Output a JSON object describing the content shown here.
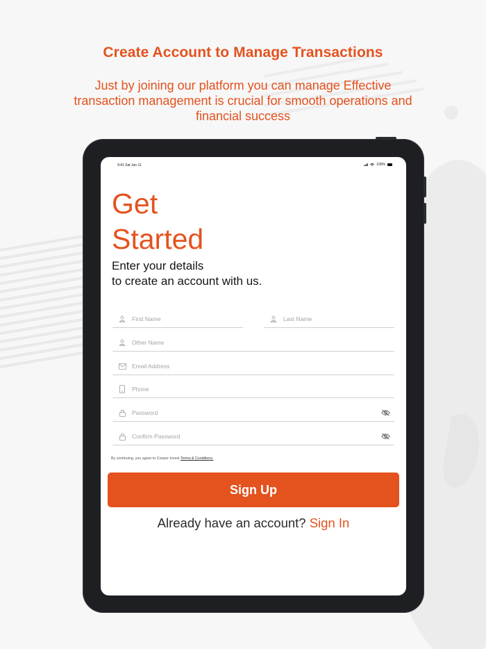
{
  "colors": {
    "accent": "#e4521e",
    "background": "#f7f7f7",
    "device_frame": "#1d1f22",
    "screen": "#ffffff"
  },
  "promo": {
    "headline": "Create Account to Manage Transactions",
    "subhead": "Just by joining our platform you can manage Effective transaction management is crucial for smooth operations and financial success"
  },
  "statusbar": {
    "time": "9:41  Sat Jun 11",
    "battery": "100%",
    "icons": [
      "signal-icon",
      "wifi-icon",
      "battery-icon"
    ]
  },
  "form": {
    "title_line1": "Get",
    "title_line2": "Started",
    "intro_line1": "Enter your details",
    "intro_line2": "to create an account with us.",
    "first_name": {
      "placeholder": "First Name",
      "icon": "person-icon"
    },
    "last_name": {
      "placeholder": "Last Name",
      "icon": "person-icon"
    },
    "other_name": {
      "placeholder": "Other Name",
      "icon": "person-icon"
    },
    "email": {
      "placeholder": "Email Address",
      "icon": "mail-icon"
    },
    "phone": {
      "placeholder": "Phone",
      "icon": "phone-icon"
    },
    "password": {
      "placeholder": "Password",
      "icon": "lock-icon",
      "toggle_icon": "eye-off-icon"
    },
    "confirm_password": {
      "placeholder": "Confirm Password",
      "icon": "lock-icon",
      "toggle_icon": "eye-off-icon"
    },
    "terms_prefix": "By continuing, you agree to Cooper Invest",
    "terms_link": "Terms & Conditions.",
    "signup_label": "Sign Up",
    "signin_prompt": "Already have an account?",
    "signin_link": "Sign In"
  }
}
